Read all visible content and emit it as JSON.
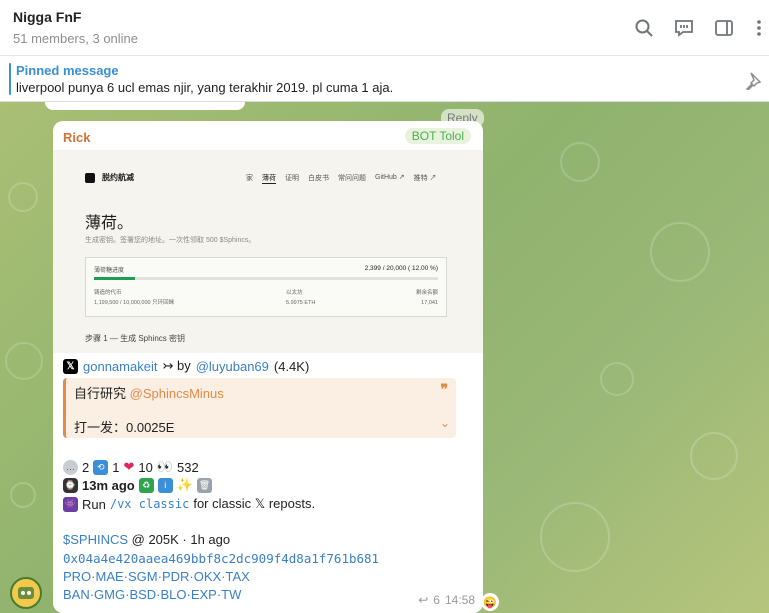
{
  "header": {
    "title": "Nigga FnF",
    "subtitle": "51 members, 3 online"
  },
  "pinned": {
    "title": "Pinned message",
    "text": "liverpool punya 6 ucl emas njir, yang terakhir 2019. pl cuma 1 aja."
  },
  "message": {
    "reply_label": "Reply",
    "sender": "Rick",
    "badge": "BOT Tolol",
    "screenshot": {
      "brand": "脱约航减",
      "nav": [
        "家",
        "薄荷",
        "证明",
        "白皮书",
        "常问问题",
        "GitHub ↗",
        "推特 ↗"
      ],
      "heading": "薄荷。",
      "subheading": "生成密钥。签署您的地址。一次性领取 500 $Sphincs。",
      "progress_label": "薄荷糖进度",
      "progress_value": "2,399 / 20,000 ( 12.00 %)",
      "progress_fraction": 0.12,
      "col1_label": "铸造的代币",
      "col1_value": "1,199,500 / 10,000,000 只环回眯",
      "col2_label": "以太坊",
      "col2_value": "5.9975 ETH",
      "col3_label": "剩余名额",
      "col3_value": "17,041",
      "step": "步骤 1 — 生成 Sphincs 密钥"
    },
    "tweet_user": "gonnamakeit",
    "tweet_arrow": "↣ by",
    "tweet_handle": "@luyuban69",
    "tweet_followers": "(4.4K)",
    "quote_line1_prefix": "自行研究 ",
    "quote_line1_mention": "@SphincsMinus",
    "quote_line2": "打一发：0.0025E",
    "stats": {
      "comments": "2",
      "reposts": "1",
      "likes": "10",
      "views": "532"
    },
    "time_ago": "13m ago",
    "run_prefix": "Run ",
    "run_command": "/vx classic",
    "run_suffix": " for classic 𝕏 reposts.",
    "ticker": "$SPHINCS",
    "ticker_info": " @ 205K · 1h ago",
    "address": "0x04a4e420aaea469bbf8c2dc909f4d8a1f761b681",
    "tags_line1": "PRO·MAE·SGM·PDR·OKX·TAX",
    "tags_line2": "BAN·GMG·BSD·BLO·EXP·TW",
    "reply_count": "6",
    "time": "14:58"
  },
  "colors": {
    "accent": "#3a8fd6",
    "sender": "#d2733a",
    "badge": "#4fae4e",
    "quote": "#e38a44"
  }
}
